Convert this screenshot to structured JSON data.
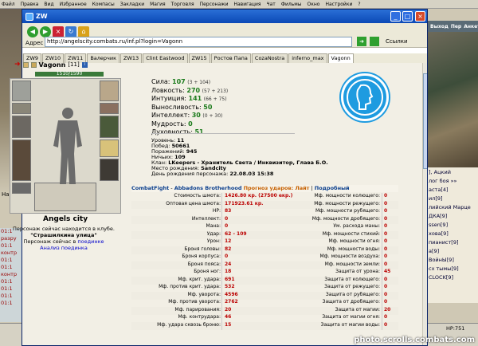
{
  "background": {
    "menu": [
      "Файл",
      "Правка",
      "Вид",
      "Избранное",
      "Компасы",
      "Закладки",
      "Магия",
      "Торговля",
      "Персонажи",
      "Навигация",
      "Чат",
      "Фильмы",
      "Окно",
      "Настройки",
      "?"
    ],
    "right_header": [
      "Выход",
      "Пер",
      "Анкета"
    ],
    "chat_lines": [
      "], Ацкий",
      "лог боя »»",
      "аста[4]",
      "ил[9]",
      "лийский Марце",
      "ДКА[9]",
      "ssen[9]",
      "хова[9]",
      "пианист[9]",
      "а[9]",
      "ВойнЫ[9]",
      "сх тымы[9]",
      "CLOCK[9]"
    ],
    "left_log": [
      "01:1",
      "разру",
      "01:1",
      "контр",
      "01:1",
      "01:1",
      "контр",
      "01:1",
      "01:1",
      "01:1",
      "01:1"
    ],
    "left_text": "На д",
    "hp_text": "HP:751",
    "watermark": "photo.scrolls.combats.com"
  },
  "window": {
    "title": "ZW",
    "address_label": "Адрес",
    "url": "http://angelscity.combats.ru/inf.pl?login=Vagonn",
    "links_label": "Ссылки",
    "tabs": [
      "ZW9",
      "ZW10",
      "ZW11",
      "Валерчик",
      "ZW13",
      "Clint Eastwood",
      "ZW15",
      "Ростов Папа",
      "CozaNostra",
      "inferno_max",
      "Vagonn"
    ],
    "active_tab": 10
  },
  "character": {
    "name": "Vagonn",
    "level": "[11]",
    "hp": "1510/1590",
    "town": "Angels city",
    "location_text": "Персонаж сейчас находится в клубе.",
    "room": "\"Страшилкина улица\"",
    "fight_text": "Персонаж сейчас в",
    "fight_link": "поединке",
    "analysis_link": "Анализ поединка"
  },
  "stats": [
    {
      "label": "Сила:",
      "value": "107",
      "bonus": "(3 + 104)"
    },
    {
      "label": "Ловкость:",
      "value": "270",
      "bonus": "(57 + 213)"
    },
    {
      "label": "Интуиция:",
      "value": "141",
      "bonus": "(66 + 75)"
    },
    {
      "label": "Выносливость:",
      "value": "50",
      "bonus": ""
    },
    {
      "label": "Интеллект:",
      "value": "30",
      "bonus": "(0 + 30)"
    },
    {
      "label": "Мудрость:",
      "value": "0",
      "bonus": ""
    },
    {
      "label": "Духовность:",
      "value": "51",
      "bonus": ""
    }
  ],
  "info": [
    {
      "label": "Уровень:",
      "value": "11"
    },
    {
      "label": "Побед:",
      "value": "50661"
    },
    {
      "label": "Поражений:",
      "value": "945"
    },
    {
      "label": "Ничьих:",
      "value": "109"
    },
    {
      "label": "Клан:",
      "value": "LKeepers - Хранитель Света / Инквизитор, Глава Б.О."
    },
    {
      "label": "Место рождения:",
      "value": "Sandcity"
    },
    {
      "label": "День рождения персонажа:",
      "value": "22.08.03 15:38"
    }
  ],
  "combat": {
    "site": "CombatFight",
    "sep": " - ",
    "guild": "Abbadons Brotherhood",
    "forecast": "Прогноз ударов:",
    "light": "Лайт",
    "pipe": "|",
    "detailed": "Подробный",
    "left": [
      {
        "label": "Стоимость шмота:",
        "value": "1426.80 кр. (27500 екр.)"
      },
      {
        "label": "Оптовая цена шмота:",
        "value": "171923.61 кр."
      },
      {
        "label": "HP:",
        "value": "83"
      },
      {
        "label": "Интеллект:",
        "value": "0"
      },
      {
        "label": "Мана:",
        "value": "0"
      },
      {
        "label": "Удар:",
        "value": "62 - 109"
      },
      {
        "label": "Урон:",
        "value": "12"
      },
      {
        "label": "Броня головы:",
        "value": "82"
      },
      {
        "label": "Броня корпуса:",
        "value": "0"
      },
      {
        "label": "Броня пояса:",
        "value": "24"
      },
      {
        "label": "Броня ног:",
        "value": "18"
      },
      {
        "label": "Мф. крит. удара:",
        "value": "691"
      },
      {
        "label": "Мф. против крит. удара:",
        "value": "532"
      },
      {
        "label": "Мф. уворота:",
        "value": "4596"
      },
      {
        "label": "Мф. против уворота:",
        "value": "2762"
      },
      {
        "label": "Мф. парирования:",
        "value": "20"
      },
      {
        "label": "Мф. контрудара:",
        "value": "46"
      },
      {
        "label": "Мф. удара сквозь броню:",
        "value": "15"
      }
    ],
    "right": [
      {
        "label": "Мф. мощности колющего:",
        "value": "0"
      },
      {
        "label": "Мф. мощности режущего:",
        "value": "0"
      },
      {
        "label": "Мф. мощности рубящего:",
        "value": "0"
      },
      {
        "label": "Мф. мощности дробящего:",
        "value": "0"
      },
      {
        "label": "Ум. расхода маны:",
        "value": "0"
      },
      {
        "label": "Мф. мощности стихий:",
        "value": "0"
      },
      {
        "label": "Мф. мощности огня:",
        "value": "0"
      },
      {
        "label": "Мф. мощности воды:",
        "value": "0"
      },
      {
        "label": "Мф. мощности воздуха:",
        "value": "0"
      },
      {
        "label": "Мф. мощности земли:",
        "value": "0"
      },
      {
        "label": "Защита от урона:",
        "value": "45"
      },
      {
        "label": "Защита от колющего:",
        "value": "0"
      },
      {
        "label": "Защита от режущего:",
        "value": "0"
      },
      {
        "label": "Защита от рубящего:",
        "value": "0"
      },
      {
        "label": "Защита от дробящего:",
        "value": "0"
      },
      {
        "label": "Защита от магии:",
        "value": "20"
      },
      {
        "label": "Защита от магии огня:",
        "value": "0"
      },
      {
        "label": "Защита от магии воды:",
        "value": "0"
      }
    ]
  }
}
